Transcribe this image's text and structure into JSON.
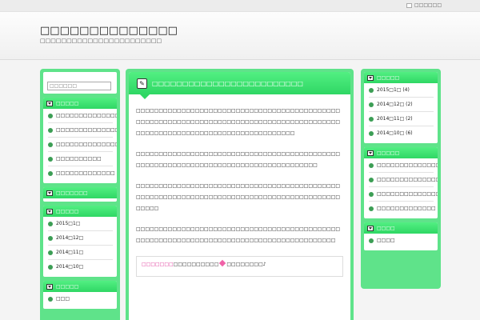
{
  "topbar": {
    "rss_label": "□□□□□□"
  },
  "header": {
    "title": "□□□□□□□□□□□□□□",
    "description": "□□□□□□□□□□□□□□□□□□□□□□□"
  },
  "left": {
    "search": {
      "placeholder": "□□□□□□"
    },
    "recent": {
      "title": "□□□□□",
      "items": [
        "□□□□□□□□□□□□□□□□□□□□□□□",
        "□□□□□□□□□□□□□□□□□□□□□□□□",
        "□□□□□□□□□□□□□□□",
        "□□□□□□□□□□",
        "□□□□□□□□□□□□□"
      ]
    },
    "comments": {
      "title": "□□□□□□□"
    },
    "archives": {
      "title": "□□□□□",
      "items": [
        "2015□1□",
        "2014□12□",
        "2014□11□",
        "2014□10□"
      ]
    },
    "categories": {
      "title": "□□□□□",
      "items": [
        "□□□"
      ]
    }
  },
  "main": {
    "post_title": "□□□□□□□□□□□□□□□□□□□□□□□□□",
    "paragraphs": [
      "□□□□□□□□□□□□□□□□□□□□□□□□□□□□□□□□□□□□□□□□□□□□□□□□□□□□□□□□□□□□□□□□□□□□□□□□□□□□□□□□□□□□□□□□□□□□□□□□□□□□□□□□□□□□□□□□□□□□□□□□□□□□□",
      "□□□□□□□□□□□□□□□□□□□□□□□□□□□□□□□□□□□□□□□□□□□□□□□□□□□□□□□□□□□□□□□□□□□□□□□□□□□□□□□□□□□□□",
      "□□□□□□□□□□□□□□□□□□□□□□□□□□□□□□□□□□□□□□□□□□□□□□□□□□□□□□□□□□□□□□□□□□□□□□□□□□□□□□□□□□□□□□□□□□□□□□□",
      "□□□□□□□□□□□□□□□□□□□□□□□□□□□□□□□□□□□□□□□□□□□□□□□□□□□□□□□□□□□□□□□□□□□□□□□□□□□□□□□□□□□□□□□□□"
    ],
    "note": {
      "link": "□□□□□□□",
      "text1": "□□□□□□□□□□",
      "text2": "□□□□□□□□♪"
    }
  },
  "right": {
    "archives": {
      "title": "□□□□□",
      "items": [
        "2015□1□ (4)",
        "2014□12□ (2)",
        "2014□11□ (2)",
        "2014□10□ (6)"
      ]
    },
    "recent": {
      "title": "□□□□□",
      "items": [
        "□□□□□□□□□□□□□□□□□□□□□□□",
        "□□□□□□□□□□□□□□□□□□□□□□□□",
        "□□□□□□□□□□□□□□□",
        "□□□□□□□□□□□□□"
      ]
    },
    "categories": {
      "title": "□□□□",
      "items": [
        "□□□□"
      ]
    }
  },
  "colors": {
    "accent": "#2fd764",
    "frame": "#5fe38a",
    "bullet": "#3c9e55",
    "link": "#e0389a"
  }
}
